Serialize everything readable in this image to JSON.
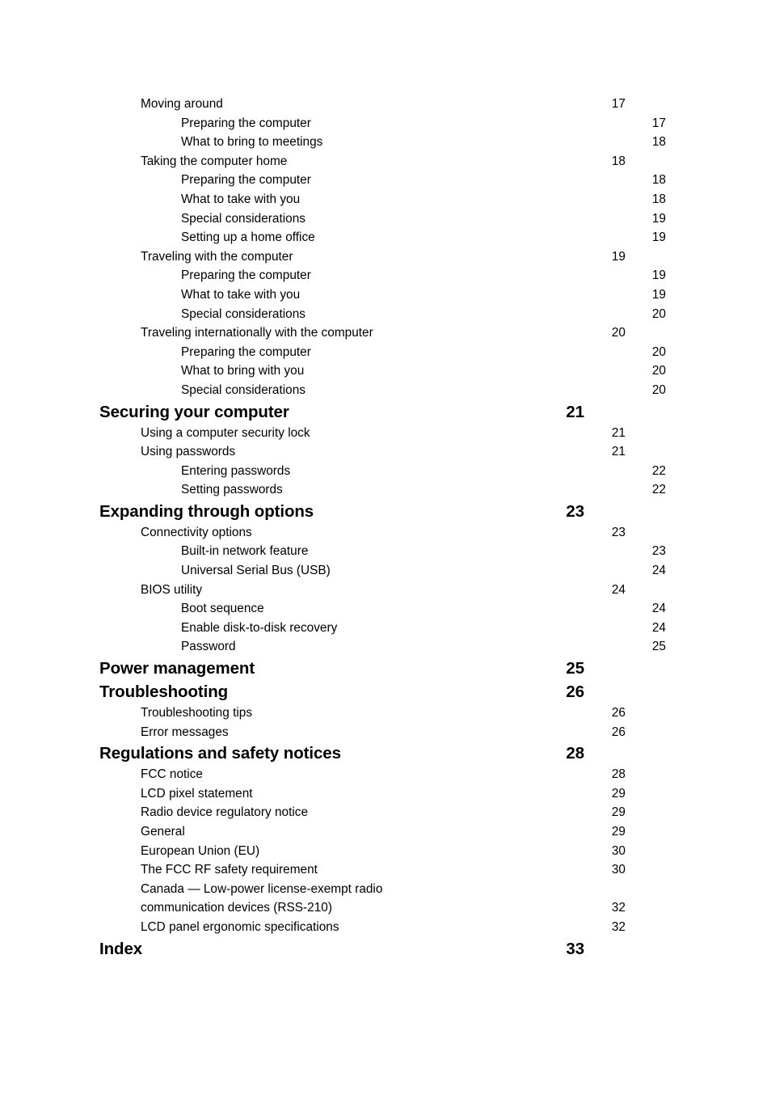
{
  "document": {
    "type": "table-of-contents",
    "page_background": "#ffffff",
    "text_color": "#000000"
  },
  "toc": {
    "entries": [
      {
        "level": 2,
        "title": "Moving around",
        "page": "17"
      },
      {
        "level": 3,
        "title": "Preparing the computer",
        "page": "17"
      },
      {
        "level": 3,
        "title": "What to bring to meetings",
        "page": "18"
      },
      {
        "level": 2,
        "title": "Taking the computer home",
        "page": "18"
      },
      {
        "level": 3,
        "title": "Preparing the computer",
        "page": "18"
      },
      {
        "level": 3,
        "title": "What to take with you",
        "page": "18"
      },
      {
        "level": 3,
        "title": "Special considerations",
        "page": "19"
      },
      {
        "level": 3,
        "title": "Setting up a home office",
        "page": "19"
      },
      {
        "level": 2,
        "title": "Traveling with the computer",
        "page": "19"
      },
      {
        "level": 3,
        "title": "Preparing the computer",
        "page": "19"
      },
      {
        "level": 3,
        "title": "What to take with you",
        "page": "19"
      },
      {
        "level": 3,
        "title": "Special considerations",
        "page": "20"
      },
      {
        "level": 2,
        "title": "Traveling internationally with the computer",
        "page": "20"
      },
      {
        "level": 3,
        "title": "Preparing the computer",
        "page": "20"
      },
      {
        "level": 3,
        "title": "What to bring with you",
        "page": "20"
      },
      {
        "level": 3,
        "title": "Special considerations",
        "page": "20"
      },
      {
        "level": 1,
        "title": "Securing your computer",
        "page": "21"
      },
      {
        "level": 2,
        "title": "Using a computer security lock",
        "page": "21"
      },
      {
        "level": 2,
        "title": "Using passwords",
        "page": "21"
      },
      {
        "level": 3,
        "title": "Entering passwords",
        "page": "22"
      },
      {
        "level": 3,
        "title": "Setting passwords",
        "page": "22"
      },
      {
        "level": 1,
        "title": "Expanding through options",
        "page": "23"
      },
      {
        "level": 2,
        "title": "Connectivity options",
        "page": "23"
      },
      {
        "level": 3,
        "title": "Built-in network feature",
        "page": "23"
      },
      {
        "level": 3,
        "title": "Universal Serial Bus (USB)",
        "page": "24"
      },
      {
        "level": 2,
        "title": "BIOS utility",
        "page": "24"
      },
      {
        "level": 3,
        "title": "Boot sequence",
        "page": "24"
      },
      {
        "level": 3,
        "title": "Enable disk-to-disk recovery",
        "page": "24"
      },
      {
        "level": 3,
        "title": "Password",
        "page": "25"
      },
      {
        "level": 1,
        "title": "Power management",
        "page": "25"
      },
      {
        "level": 1,
        "title": "Troubleshooting",
        "page": "26"
      },
      {
        "level": 2,
        "title": "Troubleshooting tips",
        "page": "26"
      },
      {
        "level": 2,
        "title": "Error messages",
        "page": "26"
      },
      {
        "level": 1,
        "title": "Regulations and safety notices",
        "page": "28"
      },
      {
        "level": 2,
        "title": "FCC notice",
        "page": "28"
      },
      {
        "level": 2,
        "title": "LCD pixel statement",
        "page": "29"
      },
      {
        "level": 2,
        "title": "Radio device regulatory notice",
        "page": "29"
      },
      {
        "level": 2,
        "title": "General",
        "page": "29"
      },
      {
        "level": 2,
        "title": "European Union (EU)",
        "page": "30"
      },
      {
        "level": 2,
        "title": "The FCC RF safety requirement",
        "page": "30"
      },
      {
        "level": 2,
        "title": "Canada — Low-power license-exempt radio",
        "title_line2": "communication devices (RSS-210)",
        "page": "32",
        "wrapped": true
      },
      {
        "level": 2,
        "title": "LCD panel ergonomic specifications",
        "page": "32"
      },
      {
        "level": 1,
        "title": "Index",
        "page": "33"
      }
    ]
  }
}
